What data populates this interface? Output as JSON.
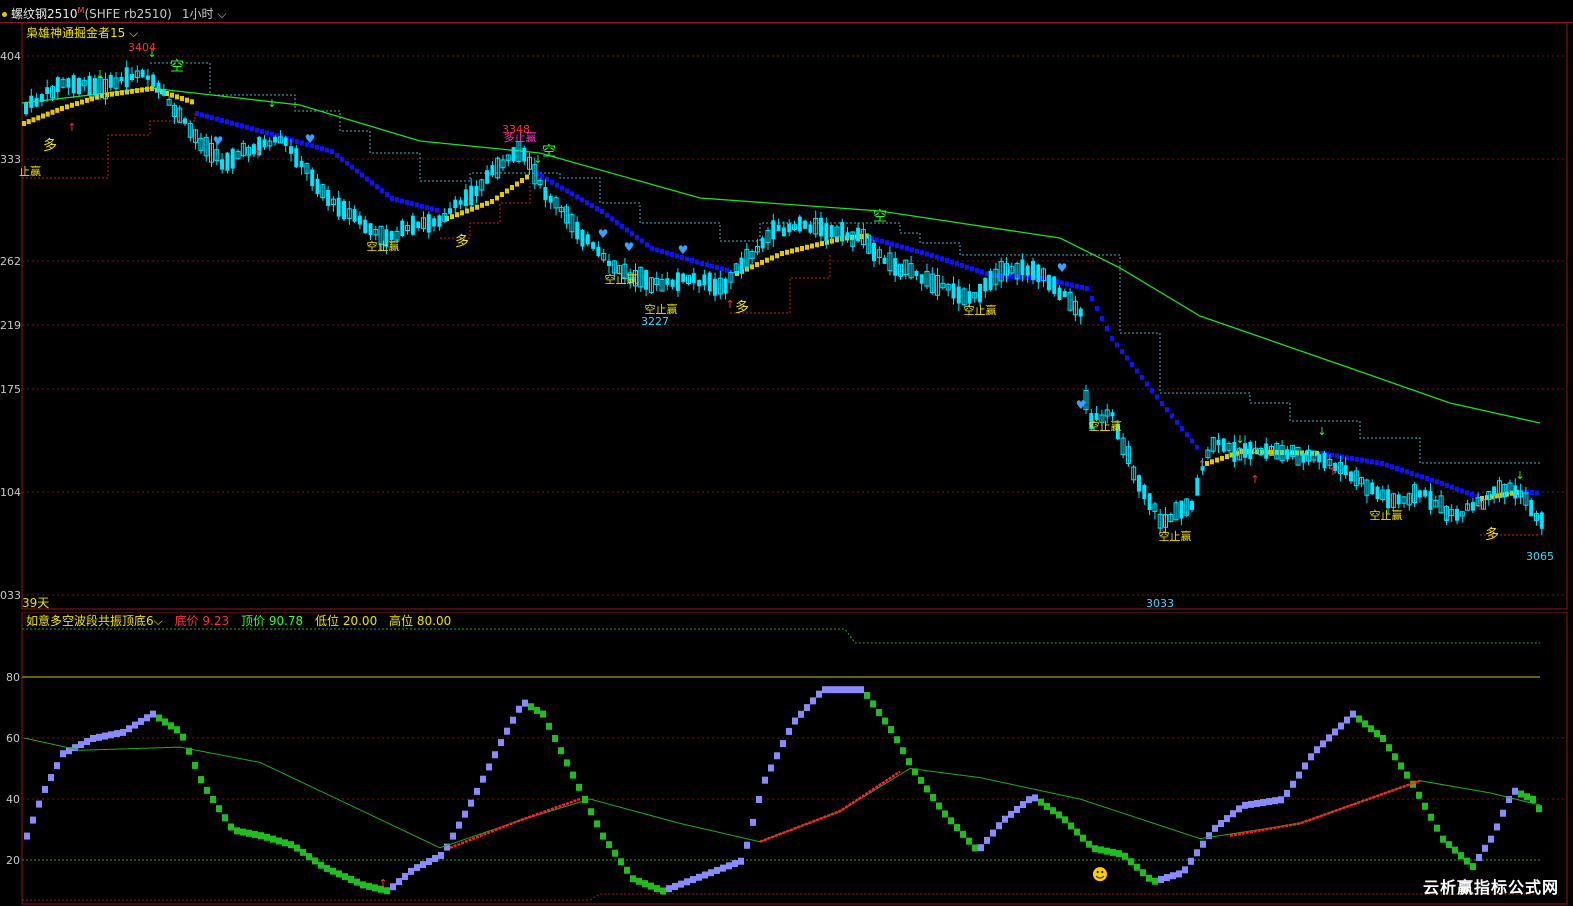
{
  "header": {
    "symbol": "螺纹钢2510",
    "superscript": "M",
    "exchange": "(SHFE rb2510)",
    "period": "1小时"
  },
  "main_indicator": {
    "name": "枭雄神通掘金者15"
  },
  "sub_indicator": {
    "name": "如意多空波段共振顶底6",
    "params": [
      {
        "label": "底价",
        "value": "9.23",
        "color": "#ff3333"
      },
      {
        "label": "顶价",
        "value": "90.78",
        "color": "#33ff33"
      },
      {
        "label": "低位",
        "value": "20.00",
        "color": "#f0e000"
      },
      {
        "label": "高位",
        "value": "80.00",
        "color": "#f0e000"
      }
    ]
  },
  "day_count": "39天",
  "watermark": "云析赢指标公式网",
  "chart_data": [
    {
      "type": "candlestick",
      "y_tick_labels": [
        "404",
        "333",
        "262",
        "219",
        "175",
        "104",
        "033"
      ],
      "annotations": {
        "high_labels": [
          "3404",
          "3348"
        ],
        "low_labels": [
          "3227",
          "3033",
          "3065"
        ],
        "long_text": "多",
        "short_text": "空",
        "stop_long": "多止赢",
        "stop_short": "空止赢",
        "short_stop_first": "止赢"
      },
      "colors": {
        "up": "#00e5ff",
        "down": "#00e5ff",
        "ma": "#22dd22",
        "trend_down": "#1010ff",
        "trend_up": "#e6c800",
        "stop_red": "#cc2222",
        "stop_cyan": "#3fb6c6"
      }
    },
    {
      "type": "line",
      "y_tick_labels": [
        "80",
        "60",
        "40",
        "20"
      ],
      "ylim": [
        5,
        95
      ],
      "reference_lines": [
        80,
        20
      ],
      "colors": {
        "rise": "#8a8aff",
        "fall": "#22bb22",
        "signal": "#22aa22",
        "signal_rise": "#ff2222"
      }
    }
  ]
}
